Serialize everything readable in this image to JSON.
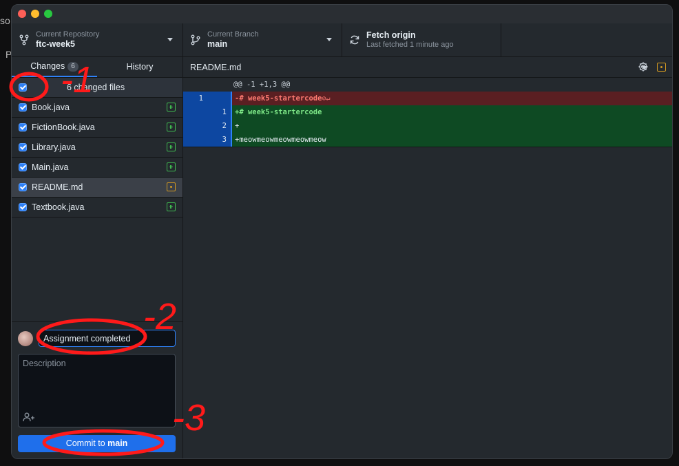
{
  "desktop": {
    "left_fragments": [
      "so",
      "P"
    ]
  },
  "toolbar": {
    "repository": {
      "label": "Current Repository",
      "value": "ftc-week5"
    },
    "branch": {
      "label": "Current Branch",
      "value": "main"
    },
    "fetch": {
      "label": "Fetch origin",
      "value": "Last fetched 1 minute ago"
    }
  },
  "sidebar": {
    "tabs": [
      {
        "label": "Changes",
        "badge": "6",
        "active": true
      },
      {
        "label": "History",
        "active": false
      }
    ],
    "header_label": "6 changed files",
    "files": [
      {
        "name": "Book.java",
        "status": "added",
        "checked": true
      },
      {
        "name": "FictionBook.java",
        "status": "added",
        "checked": true
      },
      {
        "name": "Library.java",
        "status": "added",
        "checked": true
      },
      {
        "name": "Main.java",
        "status": "added",
        "checked": true
      },
      {
        "name": "README.md",
        "status": "modified",
        "checked": true,
        "selected": true
      },
      {
        "name": "Textbook.java",
        "status": "added",
        "checked": true
      }
    ]
  },
  "commit": {
    "summary_value": "Assignment completed",
    "description_placeholder": "Description",
    "button_prefix": "Commit to ",
    "button_branch": "main"
  },
  "diff": {
    "file_title": "README.md",
    "hunk_header": "@@ -1 +1,3 @@",
    "lines": [
      {
        "type": "del",
        "old": "1",
        "new": "",
        "text": "-# week5-startercode"
      },
      {
        "type": "add",
        "old": "",
        "new": "1",
        "text": "+# week5-startercode"
      },
      {
        "type": "add",
        "old": "",
        "new": "2",
        "text": "+"
      },
      {
        "type": "add",
        "old": "",
        "new": "3",
        "text": "+meowmeowmeowmeowmeow"
      }
    ]
  },
  "annotations": [
    {
      "label": "-1"
    },
    {
      "label": "-2"
    },
    {
      "label": "-3"
    }
  ],
  "colors": {
    "accent": "#2f81f7",
    "added": "#3fb950",
    "modified": "#d29922",
    "annotation": "#ff1a1a"
  }
}
